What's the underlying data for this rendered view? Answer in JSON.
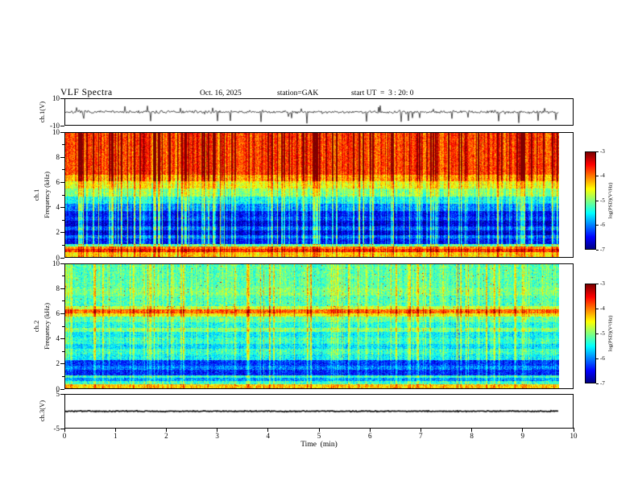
{
  "header": {
    "title": "VLF Spectra",
    "date": "Oct. 16, 2025",
    "station": "station=GAK",
    "start_ut": "start UT  =  3 : 20: 0"
  },
  "x_axis": {
    "label": "Time  (min)",
    "range": [
      0,
      10
    ],
    "ticks": [
      0,
      1,
      2,
      3,
      4,
      5,
      6,
      7,
      8,
      9,
      10
    ],
    "data_end_min": 9.7
  },
  "colorbar": {
    "label": "log(PSD)(V²/Hz)",
    "range": [
      -7,
      -3
    ],
    "ticks": [
      -3,
      -4,
      -5,
      -6,
      -7
    ]
  },
  "chart_data": [
    {
      "type": "line",
      "name": "ch1-voltage-waveform",
      "ylabel": "ch.1(V)",
      "ylim": [
        -10,
        10
      ],
      "yticks": [
        10,
        -10
      ],
      "signal": {
        "baseline": 0,
        "noise_v": 1.1,
        "spike_prob": 0.03,
        "neg_spike_max": 8.5,
        "pos_spike_max": 5,
        "line_width": 0.7
      },
      "seed": 7
    },
    {
      "type": "heatmap",
      "name": "ch1-spectrogram",
      "ylabel_channel": "ch.1",
      "ylabel_axis": "Frequency  (kHz)",
      "ylim": [
        0,
        10
      ],
      "yticks": [
        0,
        2,
        4,
        6,
        8,
        10
      ],
      "yticks_minor": [
        1,
        3,
        5,
        7,
        9
      ],
      "value_range": [
        -7,
        -3
      ],
      "freq_bands": [
        [
          0.0,
          0.4,
          -4.4
        ],
        [
          0.4,
          0.62,
          -3.7
        ],
        [
          0.62,
          0.85,
          -4.1
        ],
        [
          0.85,
          1.05,
          -5.2
        ],
        [
          1.05,
          1.5,
          -6.5
        ],
        [
          1.5,
          1.75,
          -6.1
        ],
        [
          1.75,
          2.15,
          -6.7
        ],
        [
          2.15,
          2.45,
          -6.2
        ],
        [
          2.45,
          2.95,
          -6.7
        ],
        [
          2.95,
          3.25,
          -6.3
        ],
        [
          3.25,
          3.7,
          -6.5
        ],
        [
          3.7,
          4.3,
          -6.0
        ],
        [
          4.3,
          4.9,
          -5.5
        ],
        [
          4.9,
          5.5,
          -5.0
        ],
        [
          5.5,
          6.1,
          -4.6
        ],
        [
          6.1,
          6.6,
          -4.2
        ],
        [
          6.6,
          10.0,
          -3.8
        ]
      ],
      "noise": {
        "pixel": 0.5,
        "column": 0.45
      },
      "streaks": {
        "count": 150,
        "boost_min": 0.4,
        "boost_max": 1.7,
        "profile": [
          [
            0,
            1,
            0.4
          ],
          [
            1,
            4.3,
            0.9
          ],
          [
            4.3,
            6.1,
            0.5
          ],
          [
            6.1,
            10,
            1.0
          ]
        ]
      },
      "seed": 42
    },
    {
      "type": "heatmap",
      "name": "ch2-spectrogram",
      "ylabel_channel": "ch.2",
      "ylabel_axis": "Frequency  (kHz)",
      "ylim": [
        0,
        10
      ],
      "yticks": [
        0,
        2,
        4,
        6,
        8,
        10
      ],
      "yticks_minor": [
        1,
        3,
        5,
        7,
        9
      ],
      "value_range": [
        -7,
        -3
      ],
      "freq_bands": [
        [
          0.0,
          0.3,
          -4.3
        ],
        [
          0.3,
          0.6,
          -5.3
        ],
        [
          0.6,
          0.85,
          -5.9
        ],
        [
          0.85,
          1.05,
          -5.3
        ],
        [
          1.05,
          1.5,
          -6.4
        ],
        [
          1.5,
          1.8,
          -6.0
        ],
        [
          1.8,
          2.25,
          -6.3
        ],
        [
          2.25,
          2.7,
          -5.5
        ],
        [
          2.7,
          3.2,
          -5.3
        ],
        [
          3.2,
          3.6,
          -5.6
        ],
        [
          3.6,
          4.1,
          -5.3
        ],
        [
          4.1,
          4.55,
          -5.5
        ],
        [
          4.55,
          4.85,
          -5.0
        ],
        [
          4.85,
          5.35,
          -5.4
        ],
        [
          5.35,
          5.8,
          -5.1
        ],
        [
          5.8,
          6.05,
          -4.5
        ],
        [
          6.05,
          6.35,
          -3.9
        ],
        [
          6.35,
          6.65,
          -4.7
        ],
        [
          6.65,
          7.5,
          -5.2
        ],
        [
          7.5,
          8.1,
          -5.0
        ],
        [
          8.1,
          10.0,
          -5.15
        ]
      ],
      "noise": {
        "pixel": 0.55,
        "column": 0.3
      },
      "streaks": {
        "count": 110,
        "boost_min": 0.3,
        "boost_max": 1.1,
        "profile": [
          [
            0,
            2.2,
            0.5
          ],
          [
            2.2,
            10,
            0.8
          ]
        ]
      },
      "speckle": {
        "fmin": 6.5,
        "prob": 0.004,
        "value": -3.4
      },
      "seed": 1337
    },
    {
      "type": "line",
      "name": "ch3-voltage-flat",
      "ylabel": "ch.3(V)",
      "ylim": [
        -5,
        5
      ],
      "yticks": [
        5,
        -5
      ],
      "signal": {
        "baseline": 0,
        "noise_v": 0.15,
        "line_width": 1.6
      },
      "seed": 3
    }
  ]
}
